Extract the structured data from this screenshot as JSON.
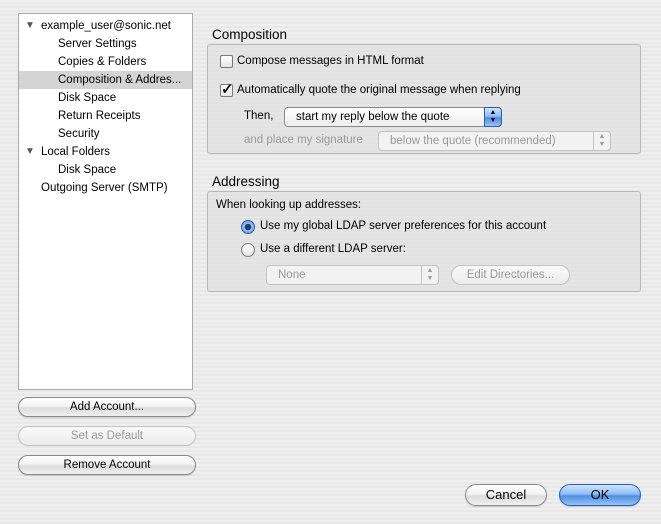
{
  "sidebar": {
    "items": [
      {
        "label": "example_user@sonic.net",
        "expanded": true
      },
      {
        "label": "Server Settings"
      },
      {
        "label": "Copies & Folders"
      },
      {
        "label": "Composition & Addres...",
        "selected": true
      },
      {
        "label": "Disk Space"
      },
      {
        "label": "Return Receipts"
      },
      {
        "label": "Security"
      },
      {
        "label": "Local Folders",
        "expanded": true
      },
      {
        "label": "Disk Space"
      },
      {
        "label": "Outgoing Server (SMTP)"
      }
    ],
    "buttons": {
      "add_account": "Add Account...",
      "set_default": "Set as Default",
      "remove_account": "Remove Account"
    }
  },
  "composition": {
    "title": "Composition",
    "html_format": {
      "label": "Compose messages in HTML format",
      "checked": false
    },
    "auto_quote": {
      "label": "Automatically quote the original message when replying",
      "checked": true
    },
    "then_label": "Then,",
    "reply_position": "start my reply below the quote",
    "signature_label": "and place my signature",
    "signature_position": "below the quote (recommended)"
  },
  "addressing": {
    "title": "Addressing",
    "lookup_label": "When looking up addresses:",
    "global_ldap": {
      "label": "Use my global LDAP server preferences for this account",
      "selected": true
    },
    "different_ldap": {
      "label": "Use a different LDAP server:",
      "selected": false
    },
    "ldap_server": "None",
    "edit_directories": "Edit Directories..."
  },
  "footer": {
    "cancel": "Cancel",
    "ok": "OK"
  },
  "icons": {
    "expand": "disclosure-triangle-down-icon",
    "check": "checkmark-icon",
    "popup_arrows": "up-down-arrows-icon"
  }
}
